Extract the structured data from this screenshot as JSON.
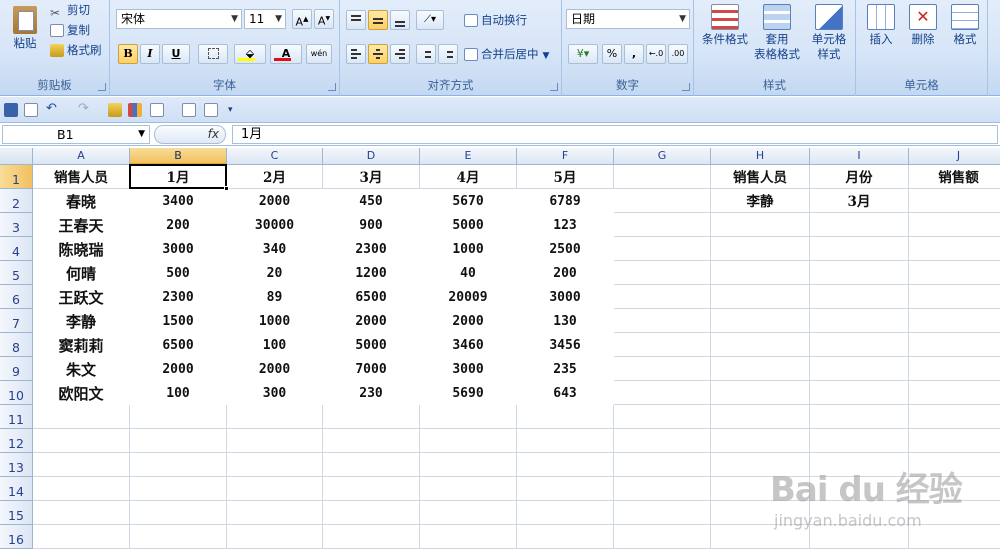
{
  "ribbon": {
    "clipboard": {
      "paste": "粘贴",
      "cut": "剪切",
      "copy": "复制",
      "format_painter": "格式刷",
      "label": "剪贴板"
    },
    "font": {
      "name": "宋体",
      "size": "11",
      "bold": "B",
      "italic": "I",
      "underline": "U",
      "font_color_letter": "A",
      "label": "字体"
    },
    "alignment": {
      "wrap_text": "自动换行",
      "merge_center": "合并后居中",
      "label": "对齐方式"
    },
    "number": {
      "format": "日期",
      "percent": "%",
      "comma": ",",
      "label": "数字"
    },
    "styles": {
      "conditional_format": "条件格式",
      "table_format_1": "套用",
      "table_format_2": "表格格式",
      "cell_styles_1": "单元格",
      "cell_styles_2": "样式",
      "label": "样式"
    },
    "cells": {
      "insert": "插入",
      "delete": "删除",
      "format": "格式",
      "label": "单元格"
    }
  },
  "formula_bar": {
    "name_box": "B1",
    "fx": "fx",
    "value": "1月"
  },
  "columns": [
    "A",
    "B",
    "C",
    "D",
    "E",
    "F",
    "G",
    "H",
    "I",
    "J"
  ],
  "rows": [
    "1",
    "2",
    "3",
    "4",
    "5",
    "6",
    "7",
    "8",
    "9",
    "10",
    "11",
    "12",
    "13",
    "14",
    "15",
    "16"
  ],
  "selected_cell": "B1",
  "table": {
    "headers": [
      "销售人员",
      "1月",
      "2月",
      "3月",
      "4月",
      "5月"
    ],
    "data": [
      [
        "春晓",
        "3400",
        "2000",
        "450",
        "5670",
        "6789"
      ],
      [
        "王春天",
        "200",
        "30000",
        "900",
        "5000",
        "123"
      ],
      [
        "陈晓瑞",
        "3000",
        "340",
        "2300",
        "1000",
        "2500"
      ],
      [
        "何晴",
        "500",
        "20",
        "1200",
        "40",
        "200"
      ],
      [
        "王跃文",
        "2300",
        "89",
        "6500",
        "20009",
        "3000"
      ],
      [
        "李静",
        "1500",
        "1000",
        "2000",
        "2000",
        "130"
      ],
      [
        "窦莉莉",
        "6500",
        "100",
        "5000",
        "3460",
        "3456"
      ],
      [
        "朱文",
        "2000",
        "2000",
        "7000",
        "3000",
        "235"
      ],
      [
        "欧阳文",
        "100",
        "300",
        "230",
        "5690",
        "643"
      ]
    ]
  },
  "lookup": {
    "headers": [
      "销售人员",
      "月份",
      "销售额"
    ],
    "values": [
      "李静",
      "3月",
      ""
    ]
  },
  "watermark": {
    "logo": "Bai du 经验",
    "url": "jingyan.baidu.com"
  }
}
